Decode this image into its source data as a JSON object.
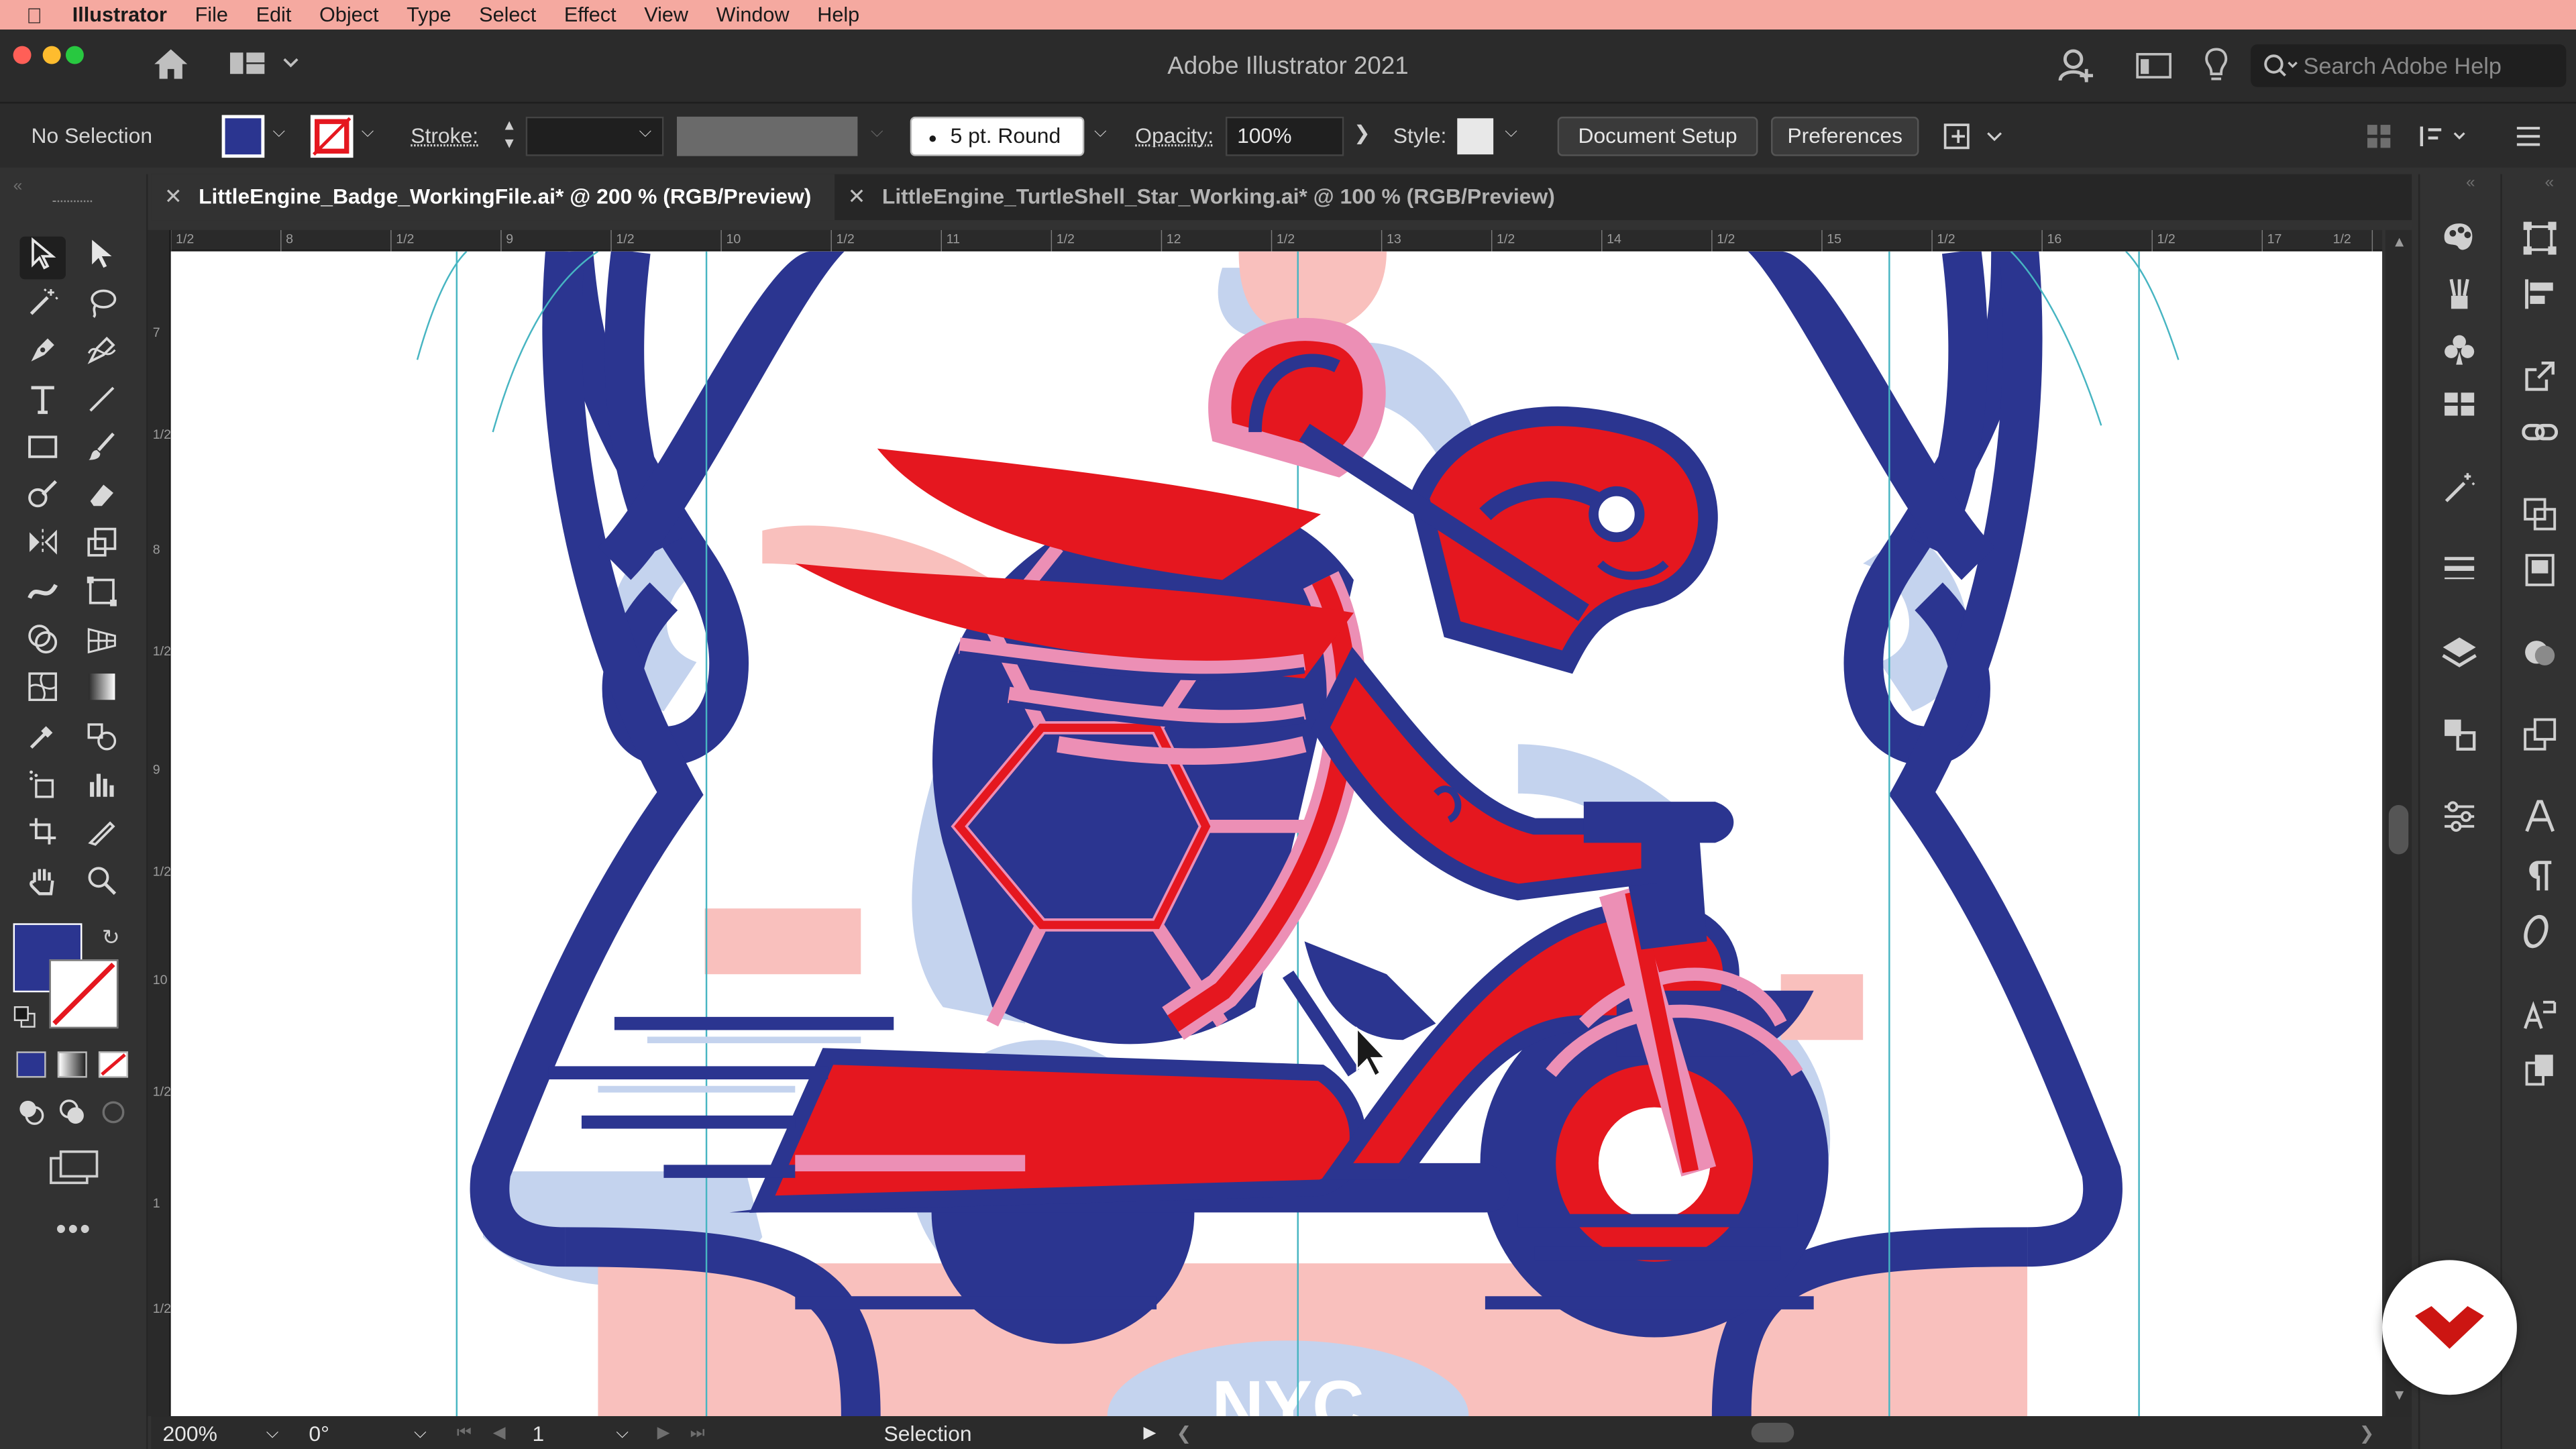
{
  "menubar": {
    "apple_icon": "apple-icon",
    "items": [
      "Illustrator",
      "File",
      "Edit",
      "Object",
      "Type",
      "Select",
      "Effect",
      "View",
      "Window",
      "Help"
    ]
  },
  "titlebar": {
    "title": "Adobe Illustrator 2021",
    "search_placeholder": "Search Adobe Help"
  },
  "control_bar": {
    "selection_status": "No Selection",
    "stroke_label": "Stroke:",
    "brush_label": "5 pt. Round",
    "opacity_label": "Opacity:",
    "opacity_value": "100%",
    "style_label": "Style:",
    "document_setup": "Document Setup",
    "preferences": "Preferences"
  },
  "tabs": [
    {
      "label": "LittleEngine_Badge_WorkingFile.ai* @ 200 % (RGB/Preview)",
      "active": true
    },
    {
      "label": "LittleEngine_TurtleShell_Star_Working.ai* @ 100 % (RGB/Preview)",
      "active": false
    }
  ],
  "rulers": {
    "horizontal": [
      "1/2",
      "8",
      "1/2",
      "9",
      "1/2",
      "10",
      "1/2",
      "11",
      "1/2",
      "12",
      "1/2",
      "13",
      "1/2",
      "14",
      "1/2",
      "15",
      "1/2",
      "16",
      "1/2",
      "17",
      "1/2"
    ],
    "vertical": [
      "7",
      "1/2",
      "8",
      "1/2",
      "9",
      "1/2",
      "10",
      "1/2",
      "1",
      "1/2"
    ]
  },
  "artwork": {
    "caption_partial": "NYC"
  },
  "status_bar": {
    "zoom": "200%",
    "rotation": "0°",
    "artboard": "1",
    "tool": "Selection"
  },
  "colors": {
    "navy": "#2b3590",
    "red": "#e5171f",
    "pink": "#ec8fb5",
    "light_pink": "#f9c0bd",
    "light_blue": "#c4d3ee",
    "guide": "#47b5c2",
    "menubar": "#f5a9a0"
  }
}
